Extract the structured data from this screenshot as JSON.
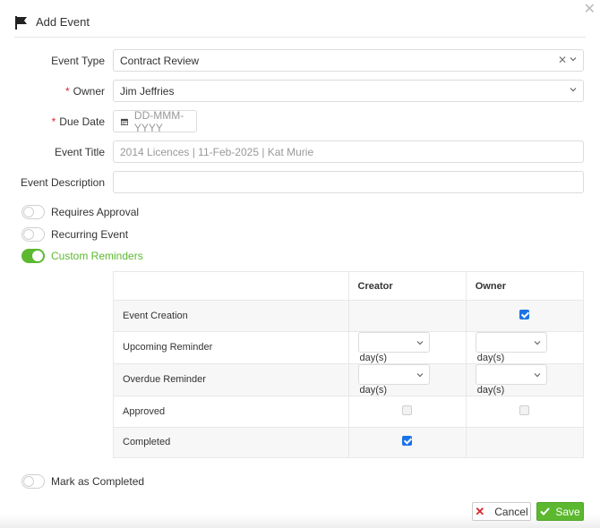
{
  "dialog": {
    "title": "Add Event",
    "close_glyph": "✕"
  },
  "form": {
    "event_type": {
      "label": "Event Type",
      "value": "Contract Review",
      "clear_glyph": "✕"
    },
    "owner": {
      "label": "Owner",
      "required_mark": "*",
      "value": "Jim Jeffries"
    },
    "due_date": {
      "label": "Due Date",
      "required_mark": "*",
      "placeholder": "DD-MMM-YYYY"
    },
    "event_title": {
      "label": "Event Title",
      "placeholder": "2014 Licences | 11-Feb-2025 | Kat Murie"
    },
    "event_description": {
      "label": "Event Description",
      "value": ""
    }
  },
  "toggles": {
    "requires_approval": {
      "label": "Requires Approval",
      "on": false
    },
    "recurring_event": {
      "label": "Recurring Event",
      "on": false
    },
    "custom_reminders": {
      "label": "Custom Reminders",
      "on": true
    },
    "mark_completed": {
      "label": "Mark as Completed",
      "on": false
    }
  },
  "reminders": {
    "headers": [
      "",
      "Creator",
      "Owner"
    ],
    "rows": [
      {
        "label": "Event Creation",
        "creator": null,
        "owner": "checked"
      },
      {
        "label": "Upcoming Reminder",
        "creator": "select",
        "owner": "select"
      },
      {
        "label": "Overdue Reminder",
        "creator": "select",
        "owner": "select"
      },
      {
        "label": "Approved",
        "creator": "unchecked",
        "owner": "unchecked"
      },
      {
        "label": "Completed",
        "creator": "checked",
        "owner": null
      }
    ],
    "days_label": "day(s)"
  },
  "buttons": {
    "cancel": "Cancel",
    "save": "Save"
  },
  "colors": {
    "accent_green": "#5cb82f",
    "checkbox_blue": "#1a73e8",
    "required_red": "#d9262c"
  }
}
